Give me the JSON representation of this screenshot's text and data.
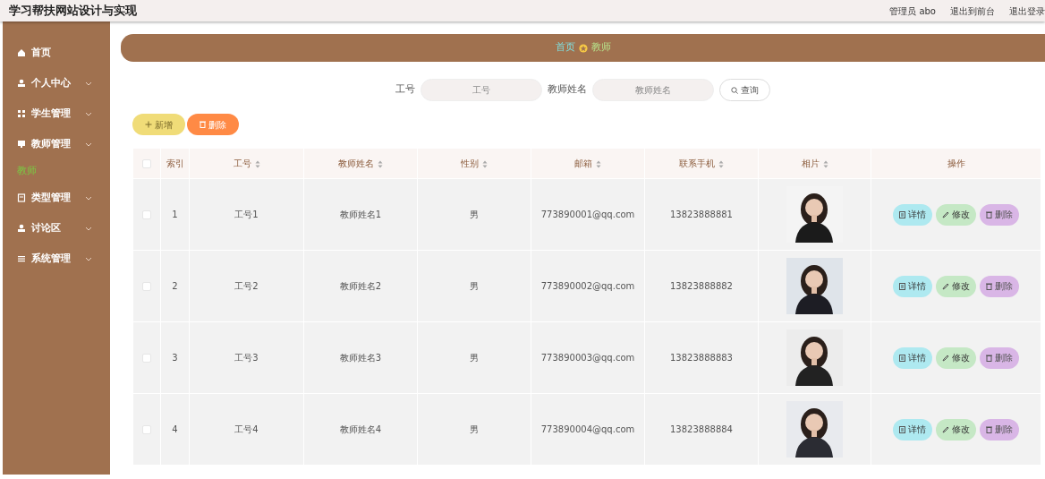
{
  "header": {
    "title": "学习帮扶网站设计与实现",
    "user": "管理员 abo",
    "links": [
      "退出到前台",
      "退出登录"
    ]
  },
  "sidebar": {
    "items": [
      {
        "label": "首页",
        "expandable": false
      },
      {
        "label": "个人中心",
        "expandable": true
      },
      {
        "label": "学生管理",
        "expandable": true
      },
      {
        "label": "教师管理",
        "expandable": true,
        "children": [
          {
            "label": "教师",
            "selected": true
          }
        ]
      },
      {
        "label": "类型管理",
        "expandable": true
      },
      {
        "label": "讨论区",
        "expandable": true
      },
      {
        "label": "系统管理",
        "expandable": true
      }
    ]
  },
  "breadcrumb": [
    "首页",
    "教师"
  ],
  "search": {
    "fields": [
      {
        "label": "工号",
        "placeholder": "工号"
      },
      {
        "label": "教师姓名",
        "placeholder": "教师姓名"
      }
    ],
    "button": "查询"
  },
  "actions": [
    {
      "label": "新增",
      "kind": "add"
    },
    {
      "label": "删除",
      "kind": "delete"
    }
  ],
  "table": {
    "select_all_checked": false,
    "columns": [
      {
        "label": "索引",
        "sortable": false
      },
      {
        "label": "工号",
        "sortable": true
      },
      {
        "label": "教师姓名",
        "sortable": true
      },
      {
        "label": "性别",
        "sortable": true
      },
      {
        "label": "邮箱",
        "sortable": true
      },
      {
        "label": "联系手机",
        "sortable": true
      },
      {
        "label": "相片",
        "sortable": true
      },
      {
        "label": "操作",
        "sortable": false
      }
    ],
    "rows": [
      {
        "checked": false,
        "cells": [
          "1",
          "工号1",
          "教师姓名1",
          "男",
          "773890001@qq.com",
          "13823888881"
        ],
        "photo": {
          "kind": "picture"
        },
        "buttons": [
          {
            "label": "详情",
            "kind": "detail"
          },
          {
            "label": "修改",
            "kind": "edit"
          },
          {
            "label": "删除",
            "kind": "delete"
          }
        ]
      },
      {
        "checked": false,
        "cells": [
          "2",
          "工号2",
          "教师姓名2",
          "男",
          "773890002@qq.com",
          "13823888882"
        ],
        "photo": {
          "kind": "picture"
        },
        "buttons": [
          {
            "label": "详情",
            "kind": "detail"
          },
          {
            "label": "修改",
            "kind": "edit"
          },
          {
            "label": "删除",
            "kind": "delete"
          }
        ]
      },
      {
        "checked": false,
        "cells": [
          "3",
          "工号3",
          "教师姓名3",
          "男",
          "773890003@qq.com",
          "13823888883"
        ],
        "photo": {
          "kind": "picture"
        },
        "buttons": [
          {
            "label": "详情",
            "kind": "detail"
          },
          {
            "label": "修改",
            "kind": "edit"
          },
          {
            "label": "删除",
            "kind": "delete"
          }
        ]
      },
      {
        "checked": false,
        "cells": [
          "4",
          "工号4",
          "教师姓名4",
          "男",
          "773890004@qq.com",
          "13823888884"
        ],
        "photo": {
          "kind": "picture"
        },
        "buttons": [
          {
            "label": "详情",
            "kind": "detail"
          },
          {
            "label": "修改",
            "kind": "edit"
          },
          {
            "label": "删除",
            "kind": "delete"
          }
        ]
      }
    ]
  }
}
